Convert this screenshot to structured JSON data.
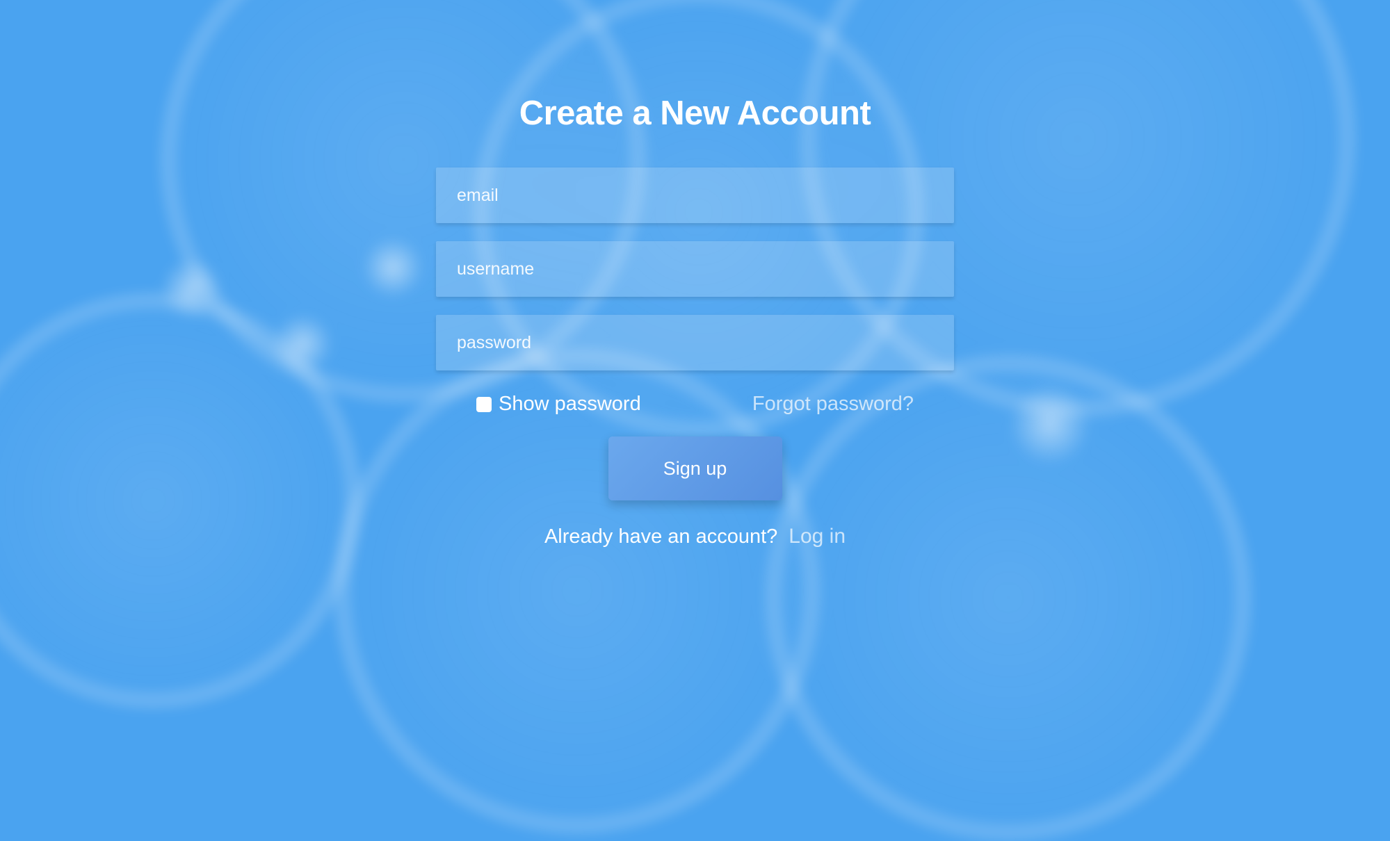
{
  "form": {
    "title": "Create a New Account",
    "email_placeholder": "email",
    "username_placeholder": "username",
    "password_placeholder": "password",
    "show_password_label": "Show password",
    "forgot_password_label": "Forgot password?",
    "submit_label": "Sign up",
    "login_prompt": "Already have an account?",
    "login_link_label": "Log in"
  }
}
